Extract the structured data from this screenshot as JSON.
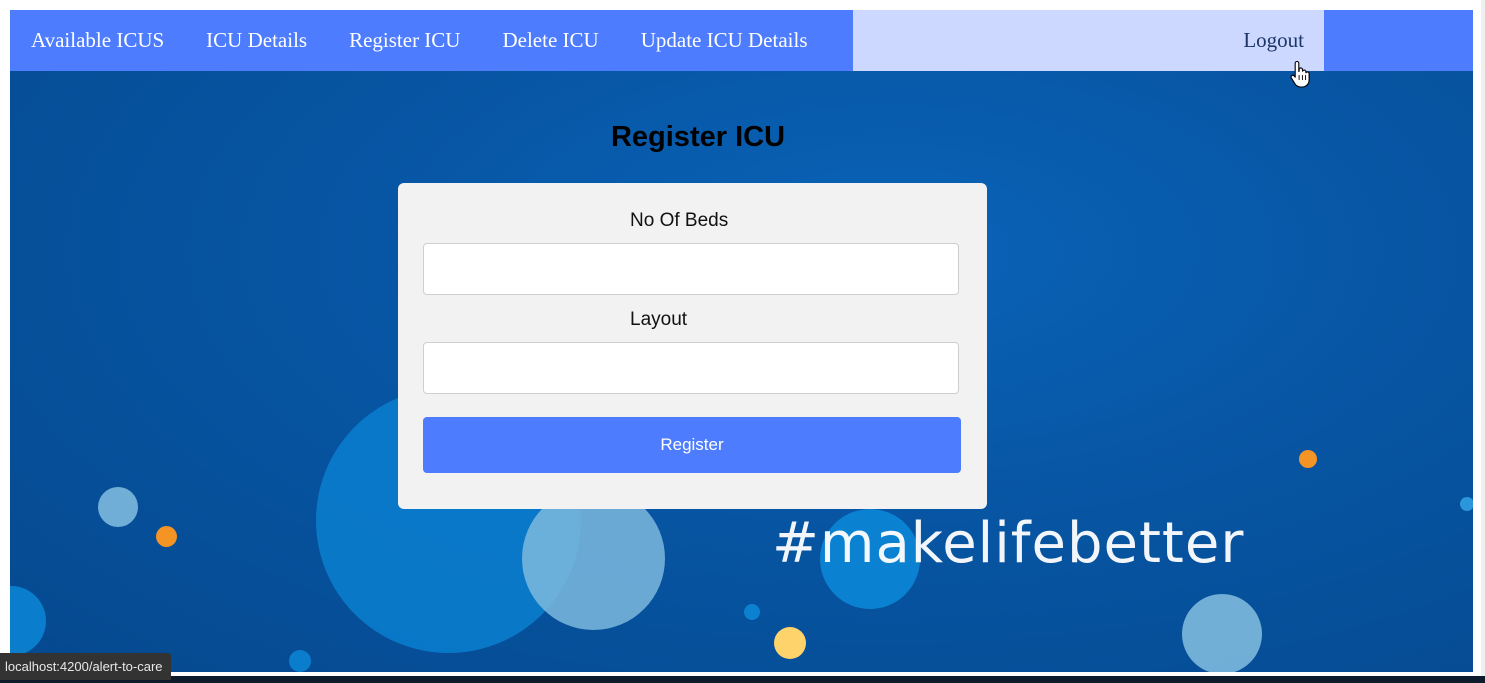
{
  "nav": {
    "items": [
      {
        "label": "Available ICUS"
      },
      {
        "label": "ICU Details"
      },
      {
        "label": "Register ICU"
      },
      {
        "label": "Delete ICU"
      },
      {
        "label": "Update ICU Details"
      }
    ],
    "logout_label": "Logout"
  },
  "page": {
    "title": "Register ICU",
    "tagline": "#makelifebetter"
  },
  "form": {
    "beds_label": "No Of Beds",
    "beds_value": "",
    "layout_label": "Layout",
    "layout_value": "",
    "submit_label": "Register"
  },
  "status_bar": {
    "url": "localhost:4200/alert-to-care"
  },
  "colors": {
    "nav_bg": "#4d7cfe",
    "nav_highlight": "#ccd8ff",
    "hero_bg": "#0755a3",
    "button_bg": "#4d7cfe",
    "card_bg": "#f2f2f2"
  },
  "icons": {
    "cursor": "hand-pointer-icon"
  }
}
